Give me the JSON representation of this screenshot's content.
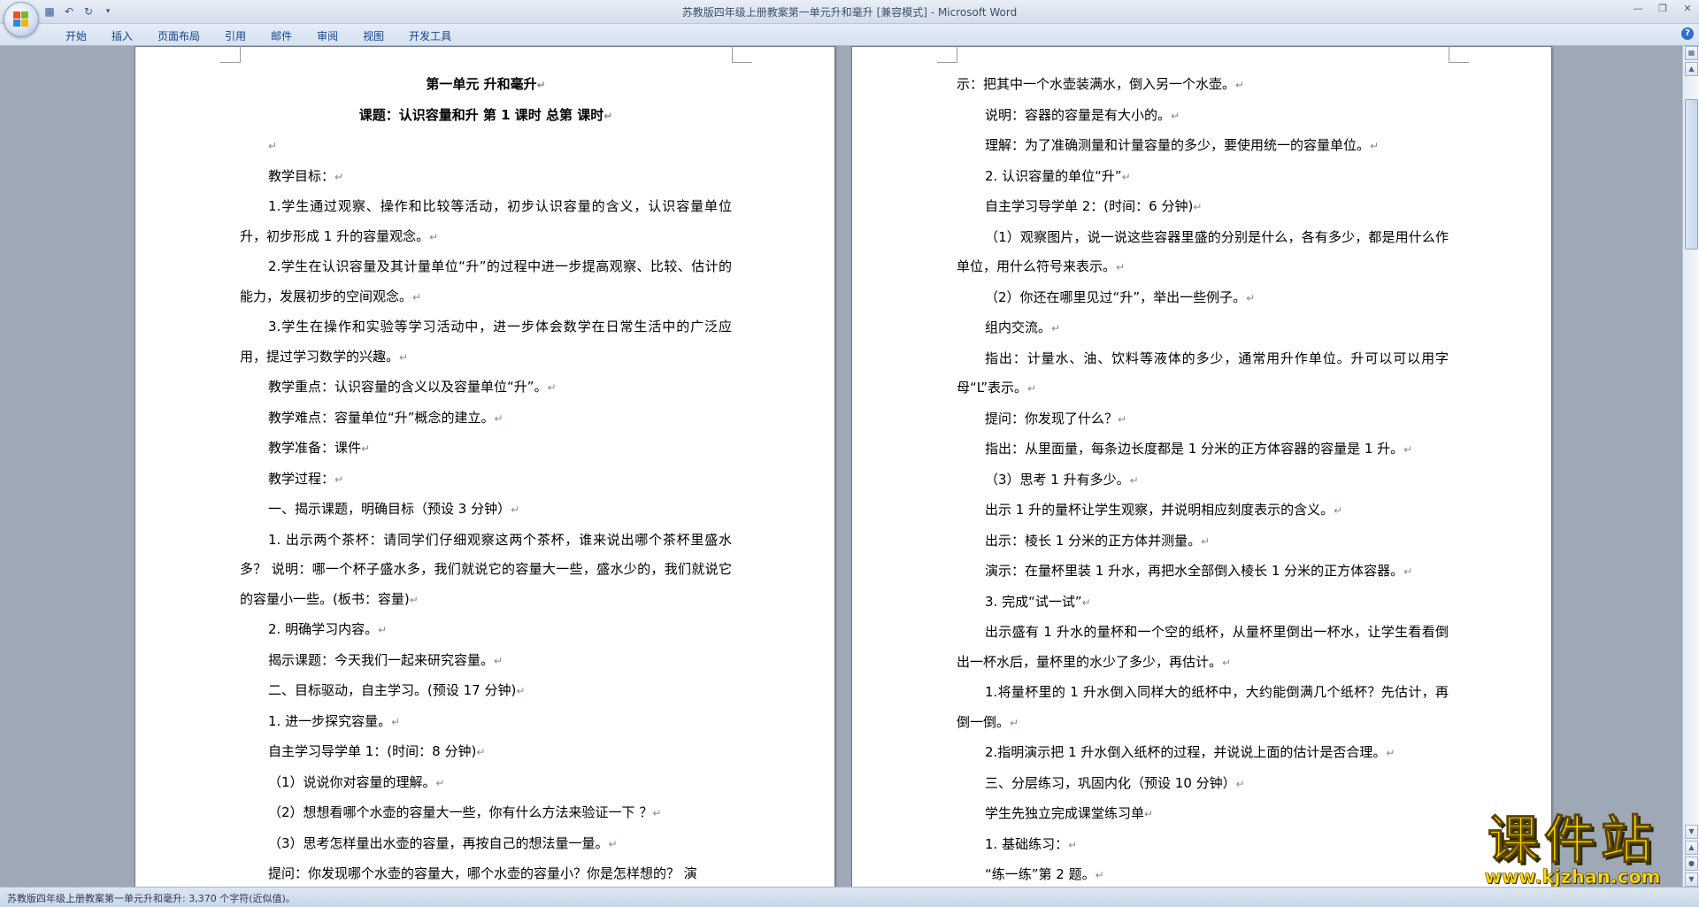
{
  "window": {
    "title": "苏教版四年级上册教案第一单元升和毫升 [兼容模式]",
    "title_separator": " - ",
    "app_name": "Microsoft Word"
  },
  "quick_access": [
    {
      "icon": "save-icon",
      "glyph": "💾"
    },
    {
      "icon": "undo-icon",
      "glyph": "↶"
    },
    {
      "icon": "redo-icon",
      "glyph": "↻"
    },
    {
      "icon": "customize-dropdown-icon",
      "glyph": "▾"
    }
  ],
  "ribbon": {
    "tabs": [
      "开始",
      "插入",
      "页面布局",
      "引用",
      "邮件",
      "审阅",
      "视图",
      "开发工具"
    ]
  },
  "left_page": {
    "paragraphs": [
      {
        "text": "第一单元 升和毫升",
        "style": "center"
      },
      {
        "text": "课题：认识容量和升 第 1 课时 总第 课时",
        "style": "center"
      },
      {
        "text": "",
        "style": "indent"
      },
      {
        "text": "教学目标：",
        "style": "indent"
      },
      {
        "text": "1.学生通过观察、操作和比较等活动，初步认识容量的含义，认识容量单位升，初步形成 1 升的容量观念。",
        "style": "indent"
      },
      {
        "text": "2.学生在认识容量及其计量单位“升”的过程中进一步提高观察、比较、估计的能力，发展初步的空间观念。",
        "style": "indent"
      },
      {
        "text": "3.学生在操作和实验等学习活动中，进一步体会数学在日常生活中的广泛应用，提过学习数学的兴趣。",
        "style": "indent"
      },
      {
        "text": "教学重点：认识容量的含义以及容量单位“升”。",
        "style": "indent"
      },
      {
        "text": "教学难点：容量单位“升”概念的建立。",
        "style": "indent"
      },
      {
        "text": "教学准备：课件",
        "style": "indent"
      },
      {
        "text": "教学过程：",
        "style": "indent"
      },
      {
        "text": "一、揭示课题，明确目标（预设 3 分钟）",
        "style": "indent"
      },
      {
        "text": "1. 出示两个茶杯：请同学们仔细观察这两个茶杯，谁来说出哪个茶杯里盛水多？ 说明：哪一个杯子盛水多，我们就说它的容量大一些，盛水少的，我们就说它的容量小一些。(板书：容量)",
        "style": "indent"
      },
      {
        "text": "2. 明确学习内容。",
        "style": "indent"
      },
      {
        "text": "揭示课题：今天我们一起来研究容量。",
        "style": "indent"
      },
      {
        "text": "二、目标驱动，自主学习。(预设 17 分钟)",
        "style": "indent"
      },
      {
        "text": "1. 进一步探究容量。",
        "style": "indent"
      },
      {
        "text": "自主学习导学单 1：(时间：8 分钟)",
        "style": "indent"
      },
      {
        "text": "（1）说说你对容量的理解。",
        "style": "indent"
      },
      {
        "text": "（2）想想看哪个水壶的容量大一些，你有什么方法来验证一下 ？",
        "style": "indent"
      },
      {
        "text": "（3）思考怎样量出水壶的容量，再按自己的想法量一量。",
        "style": "indent"
      },
      {
        "text": "提问：你发现哪个水壶的容量大，哪个水壶的容量小？你是怎样想的？ 演",
        "style": "indent-nomark"
      }
    ]
  },
  "right_page": {
    "paragraphs": [
      {
        "text": "示：把其中一个水壶装满水，倒入另一个水壶。",
        "style": "plain"
      },
      {
        "text": "说明：容器的容量是有大小的。",
        "style": "indent"
      },
      {
        "text": "理解：为了准确测量和计量容量的多少，要使用统一的容量单位。",
        "style": "indent"
      },
      {
        "text": "2. 认识容量的单位“升”",
        "style": "indent"
      },
      {
        "text": "自主学习导学单 2：(时间：6 分钟)",
        "style": "indent"
      },
      {
        "text": "（1）观察图片，说一说这些容器里盛的分别是什么，各有多少，都是用什么作单位，用什么符号来表示。",
        "style": "indent"
      },
      {
        "text": "（2）你还在哪里见过“升”，举出一些例子。",
        "style": "indent"
      },
      {
        "text": "组内交流。",
        "style": "indent"
      },
      {
        "text": "指出：计量水、油、饮料等液体的多少，通常用升作单位。升可以可以用字母“L”表示。",
        "style": "indent"
      },
      {
        "text": "提问：你发现了什么？",
        "style": "indent"
      },
      {
        "text": "指出：从里面量，每条边长度都是 1 分米的正方体容器的容量是 1 升。",
        "style": "indent"
      },
      {
        "text": "（3）思考 1 升有多少。",
        "style": "indent"
      },
      {
        "text": "出示 1 升的量杯让学生观察，并说明相应刻度表示的含义。",
        "style": "indent"
      },
      {
        "text": "出示：棱长 1 分米的正方体并测量。",
        "style": "indent"
      },
      {
        "text": "演示：在量杯里装 1 升水，再把水全部倒入棱长 1 分米的正方体容器。",
        "style": "indent"
      },
      {
        "text": "3. 完成“试一试”",
        "style": "indent"
      },
      {
        "text": "出示盛有 1 升水的量杯和一个空的纸杯，从量杯里倒出一杯水，让学生看看倒出一杯水后，量杯里的水少了多少，再估计。",
        "style": "indent"
      },
      {
        "text": "1.将量杯里的 1 升水倒入同样大的纸杯中，大约能倒满几个纸杯？先估计，再倒一倒。",
        "style": "indent"
      },
      {
        "text": "2.指明演示把 1 升水倒入纸杯的过程，并说说上面的估计是否合理。",
        "style": "indent"
      },
      {
        "text": "三、分层练习，巩固内化（预设 10 分钟）",
        "style": "indent"
      },
      {
        "text": "学生先独立完成课堂练习单",
        "style": "indent"
      },
      {
        "text": "1. 基础练习：",
        "style": "indent"
      },
      {
        "text": "“练一练”第 2 题。",
        "style": "indent"
      }
    ]
  },
  "paragraph_mark": "↵",
  "status_bar": {
    "text": "苏教版四年级上册教案第一单元升和毫升: 3,370 个字符(近似值)。"
  },
  "watermark": {
    "logo_text": "课件站",
    "url": "www.kjzhan.com"
  },
  "colors": {
    "brand_yellow": "#ffd900",
    "ribbon_text": "#15428b",
    "workspace": "#9ea8b6"
  }
}
